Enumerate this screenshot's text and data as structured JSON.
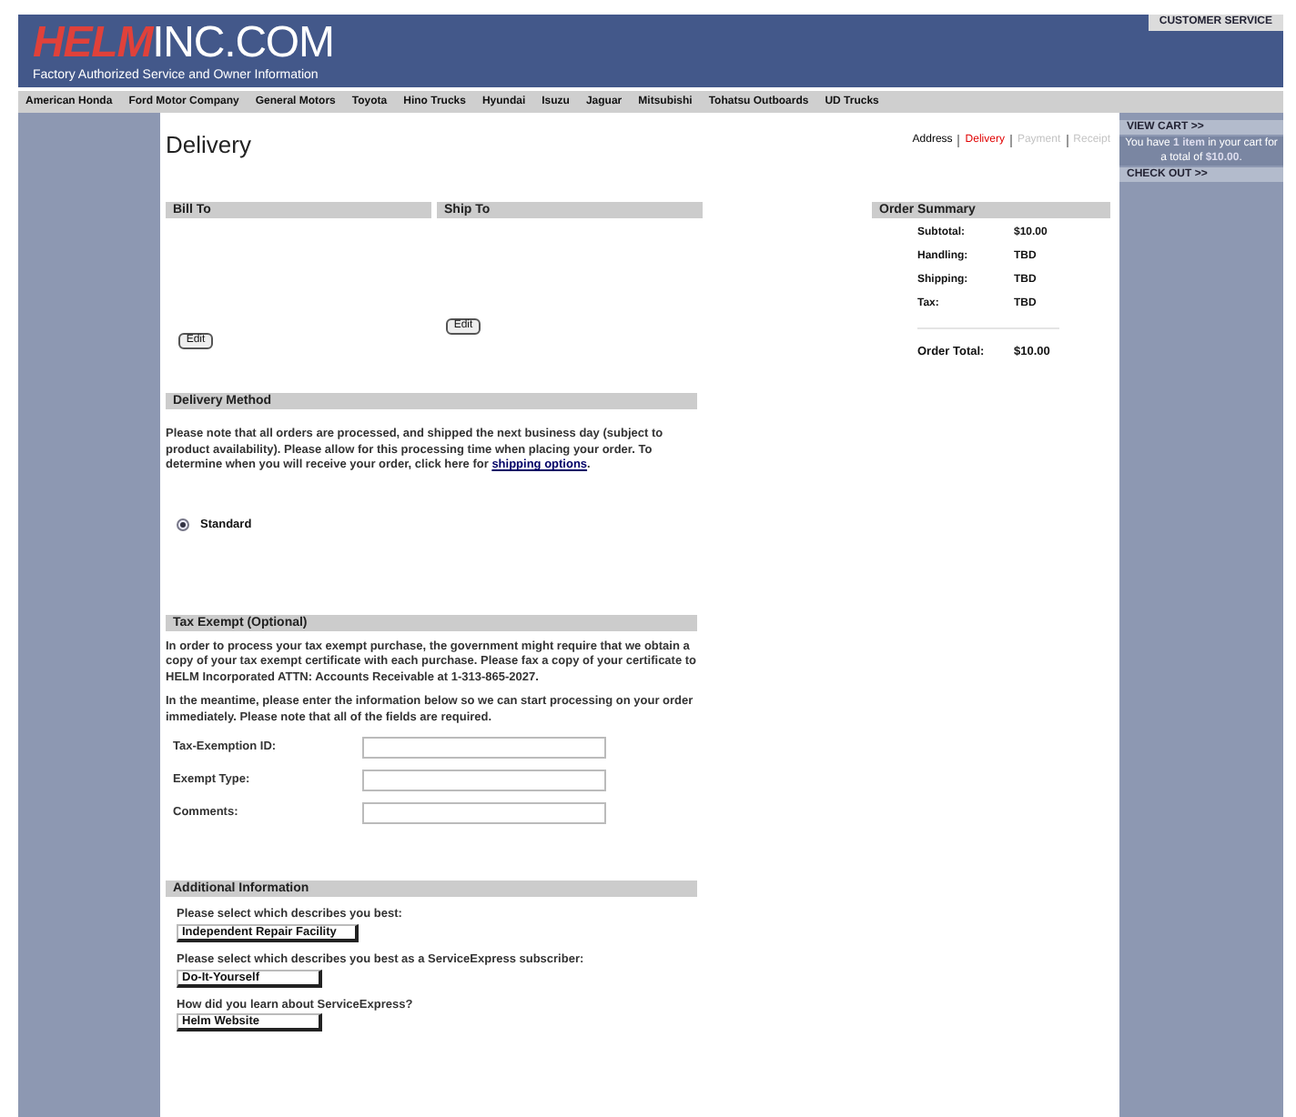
{
  "header": {
    "logo_left": "HELM",
    "logo_right": "INC.COM",
    "tagline": "Factory Authorized Service and Owner Information",
    "customer_service": "CUSTOMER SERVICE"
  },
  "nav": [
    "American Honda",
    "Ford Motor Company",
    "General Motors",
    "Toyota",
    "Hino Trucks",
    "Hyundai",
    "Isuzu",
    "Jaguar",
    "Mitsubishi",
    "Tohatsu Outboards",
    "UD Trucks"
  ],
  "page_title": "Delivery",
  "steps": [
    {
      "label": "Address",
      "selected": false,
      "disabled": false
    },
    {
      "label": "Delivery",
      "selected": true,
      "disabled": false
    },
    {
      "label": "Payment",
      "selected": false,
      "disabled": true
    },
    {
      "label": "Receipt",
      "selected": false,
      "disabled": true
    }
  ],
  "cart": {
    "view_cart": "VIEW CART >>",
    "text_before": "You have",
    "count": "1",
    "item_word": "item",
    "text_middle": "in your cart for a total of",
    "total": "$10.00",
    "text_end": ".",
    "check_out": "CHECK OUT >>"
  },
  "bill_to": {
    "title": "Bill To",
    "edit": "Edit"
  },
  "ship_to": {
    "title": "Ship To",
    "edit": "Edit"
  },
  "order_summary": {
    "title": "Order Summary",
    "rows": [
      {
        "label": "Subtotal:",
        "value": "$10.00"
      },
      {
        "label": "Handling:",
        "value": "TBD"
      },
      {
        "label": "Shipping:",
        "value": "TBD"
      },
      {
        "label": "Tax:",
        "value": "TBD"
      }
    ],
    "total_label": "Order Total:",
    "total_value": "$10.00"
  },
  "delivery_method": {
    "title": "Delivery Method",
    "note": "Please note that all orders are processed, and shipped the next business day (subject to product availability). Please allow for this processing time when placing your order. To determine when you will receive your order, click here for",
    "link": "shipping options",
    "note_end": ".",
    "options": [
      {
        "label": "Standard",
        "selected": true
      }
    ]
  },
  "tax_exempt": {
    "title": "Tax Exempt (Optional)",
    "paragraphs": [
      "In order to process your tax exempt purchase, the government might require that we obtain a copy of your tax exempt certificate with each purchase. Please fax a copy of your certificate to HELM Incorporated ATTN: Accounts Receivable at 1-313-865-2027.",
      "In the meantime, please enter the information below so we can start processing on your order immediately. Please note that all of the fields are required."
    ],
    "fields": [
      "Tax-Exemption ID:",
      "Exempt Type:",
      "Comments:"
    ]
  },
  "additional": {
    "title": "Additional Information",
    "selects": [
      {
        "label": "Please select which describes you best:",
        "value": "Independent Repair Facility"
      },
      {
        "label": "Please select which describes you best as a ServiceExpress subscriber:",
        "value": "Do-It-Yourself"
      },
      {
        "label": "How did you learn about ServiceExpress?",
        "value": "Helm Website"
      }
    ]
  }
}
